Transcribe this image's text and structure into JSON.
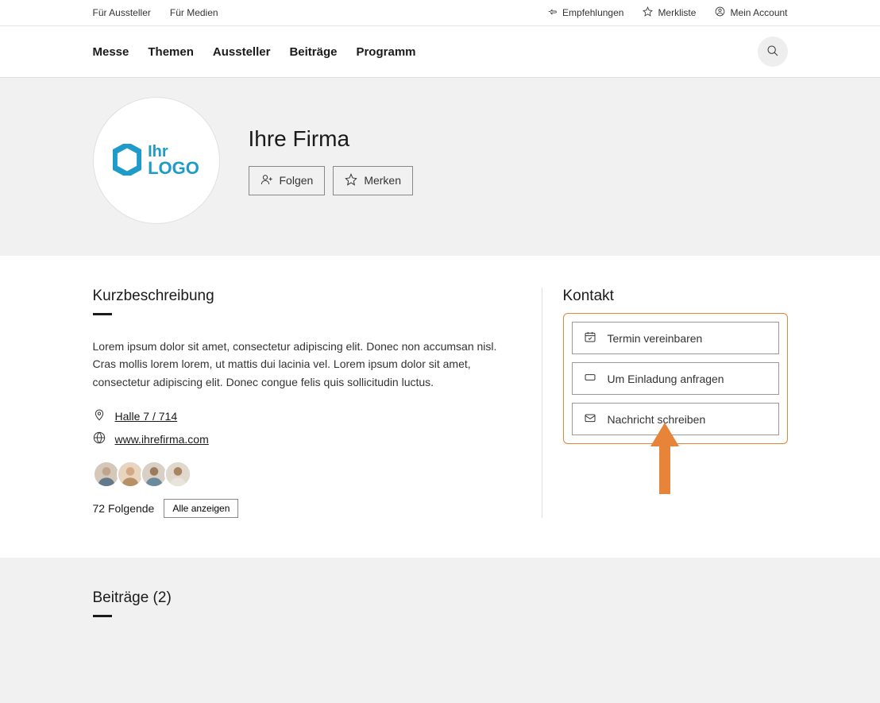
{
  "topbar": {
    "left": [
      "Für Aussteller",
      "Für Medien"
    ],
    "right": {
      "recommendations": "Empfehlungen",
      "watchlist": "Merkliste",
      "account": "Mein Account"
    }
  },
  "nav": [
    "Messe",
    "Themen",
    "Aussteller",
    "Beiträge",
    "Programm"
  ],
  "company": {
    "name": "Ihre Firma",
    "logo_line1": "Ihr",
    "logo_line2": "LOGO",
    "follow_label": "Folgen",
    "bookmark_label": "Merken"
  },
  "description": {
    "heading": "Kurzbeschreibung",
    "text": "Lorem ipsum dolor sit amet, consectetur adipiscing elit. Donec non accumsan nisl. Cras mollis lorem lorem, ut mattis dui lacinia vel. Lorem ipsum dolor sit amet, consectetur adipiscing elit. Donec congue felis quis sollicitudin luctus.",
    "location": "Halle 7 / 714",
    "website": "www.ihrefirma.com",
    "followers_count": "72 Folgende",
    "show_all": "Alle anzeigen"
  },
  "contact": {
    "heading": "Kontakt",
    "appointment": "Termin vereinbaren",
    "invitation": "Um Einladung anfragen",
    "message": "Nachricht schreiben"
  },
  "posts": {
    "heading": "Beiträge (2)"
  }
}
